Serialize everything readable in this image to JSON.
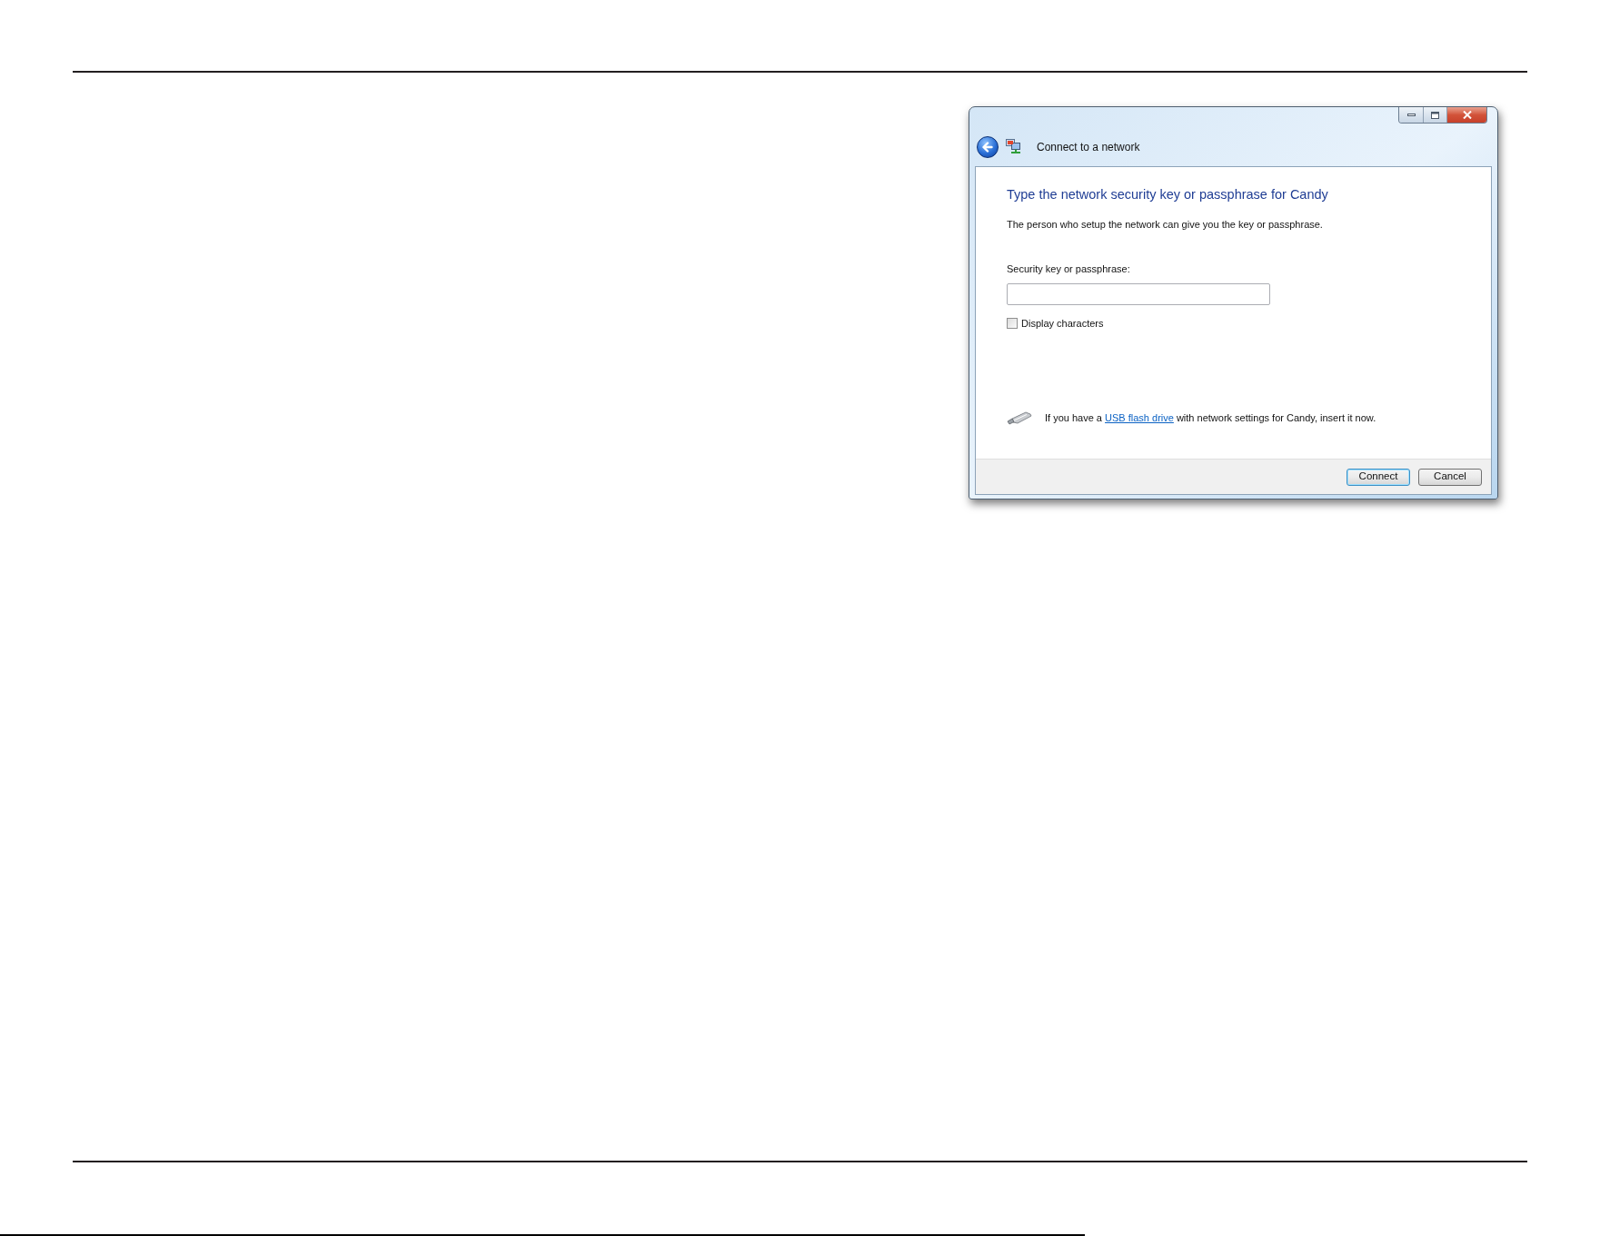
{
  "window": {
    "title": "Connect to a network"
  },
  "content": {
    "heading": "Type the network security key or passphrase for Candy",
    "description": "The person who setup the network can give you the key or passphrase.",
    "key_field": {
      "label": "Security key or passphrase:"
    },
    "checkbox": {
      "label": "Display characters",
      "checked": false
    },
    "usb_hint": {
      "text_before": "If you have a ",
      "link": "USB flash drive",
      "text_after": " with network settings for Candy, insert it now."
    }
  },
  "buttons": [
    {
      "label": "Connect",
      "default": true
    },
    {
      "label": "Cancel",
      "default": false
    }
  ]
}
